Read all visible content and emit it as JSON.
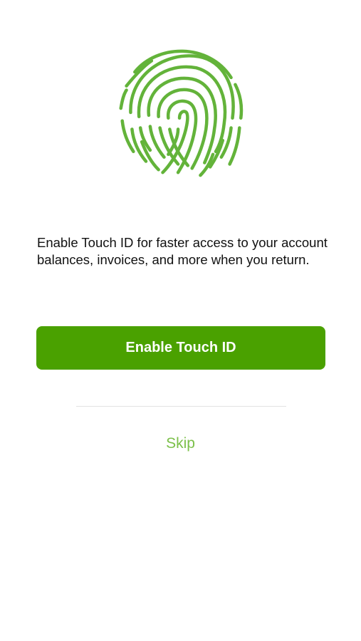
{
  "icon": {
    "name": "fingerprint-icon",
    "color": "#63b33a"
  },
  "message": "Enable Touch ID for faster access to your account balances, invoices, and more when you return.",
  "primary_button": {
    "label": "Enable Touch ID",
    "color": "#4aa100"
  },
  "skip_button": {
    "label": "Skip",
    "color": "#7cc04a"
  }
}
